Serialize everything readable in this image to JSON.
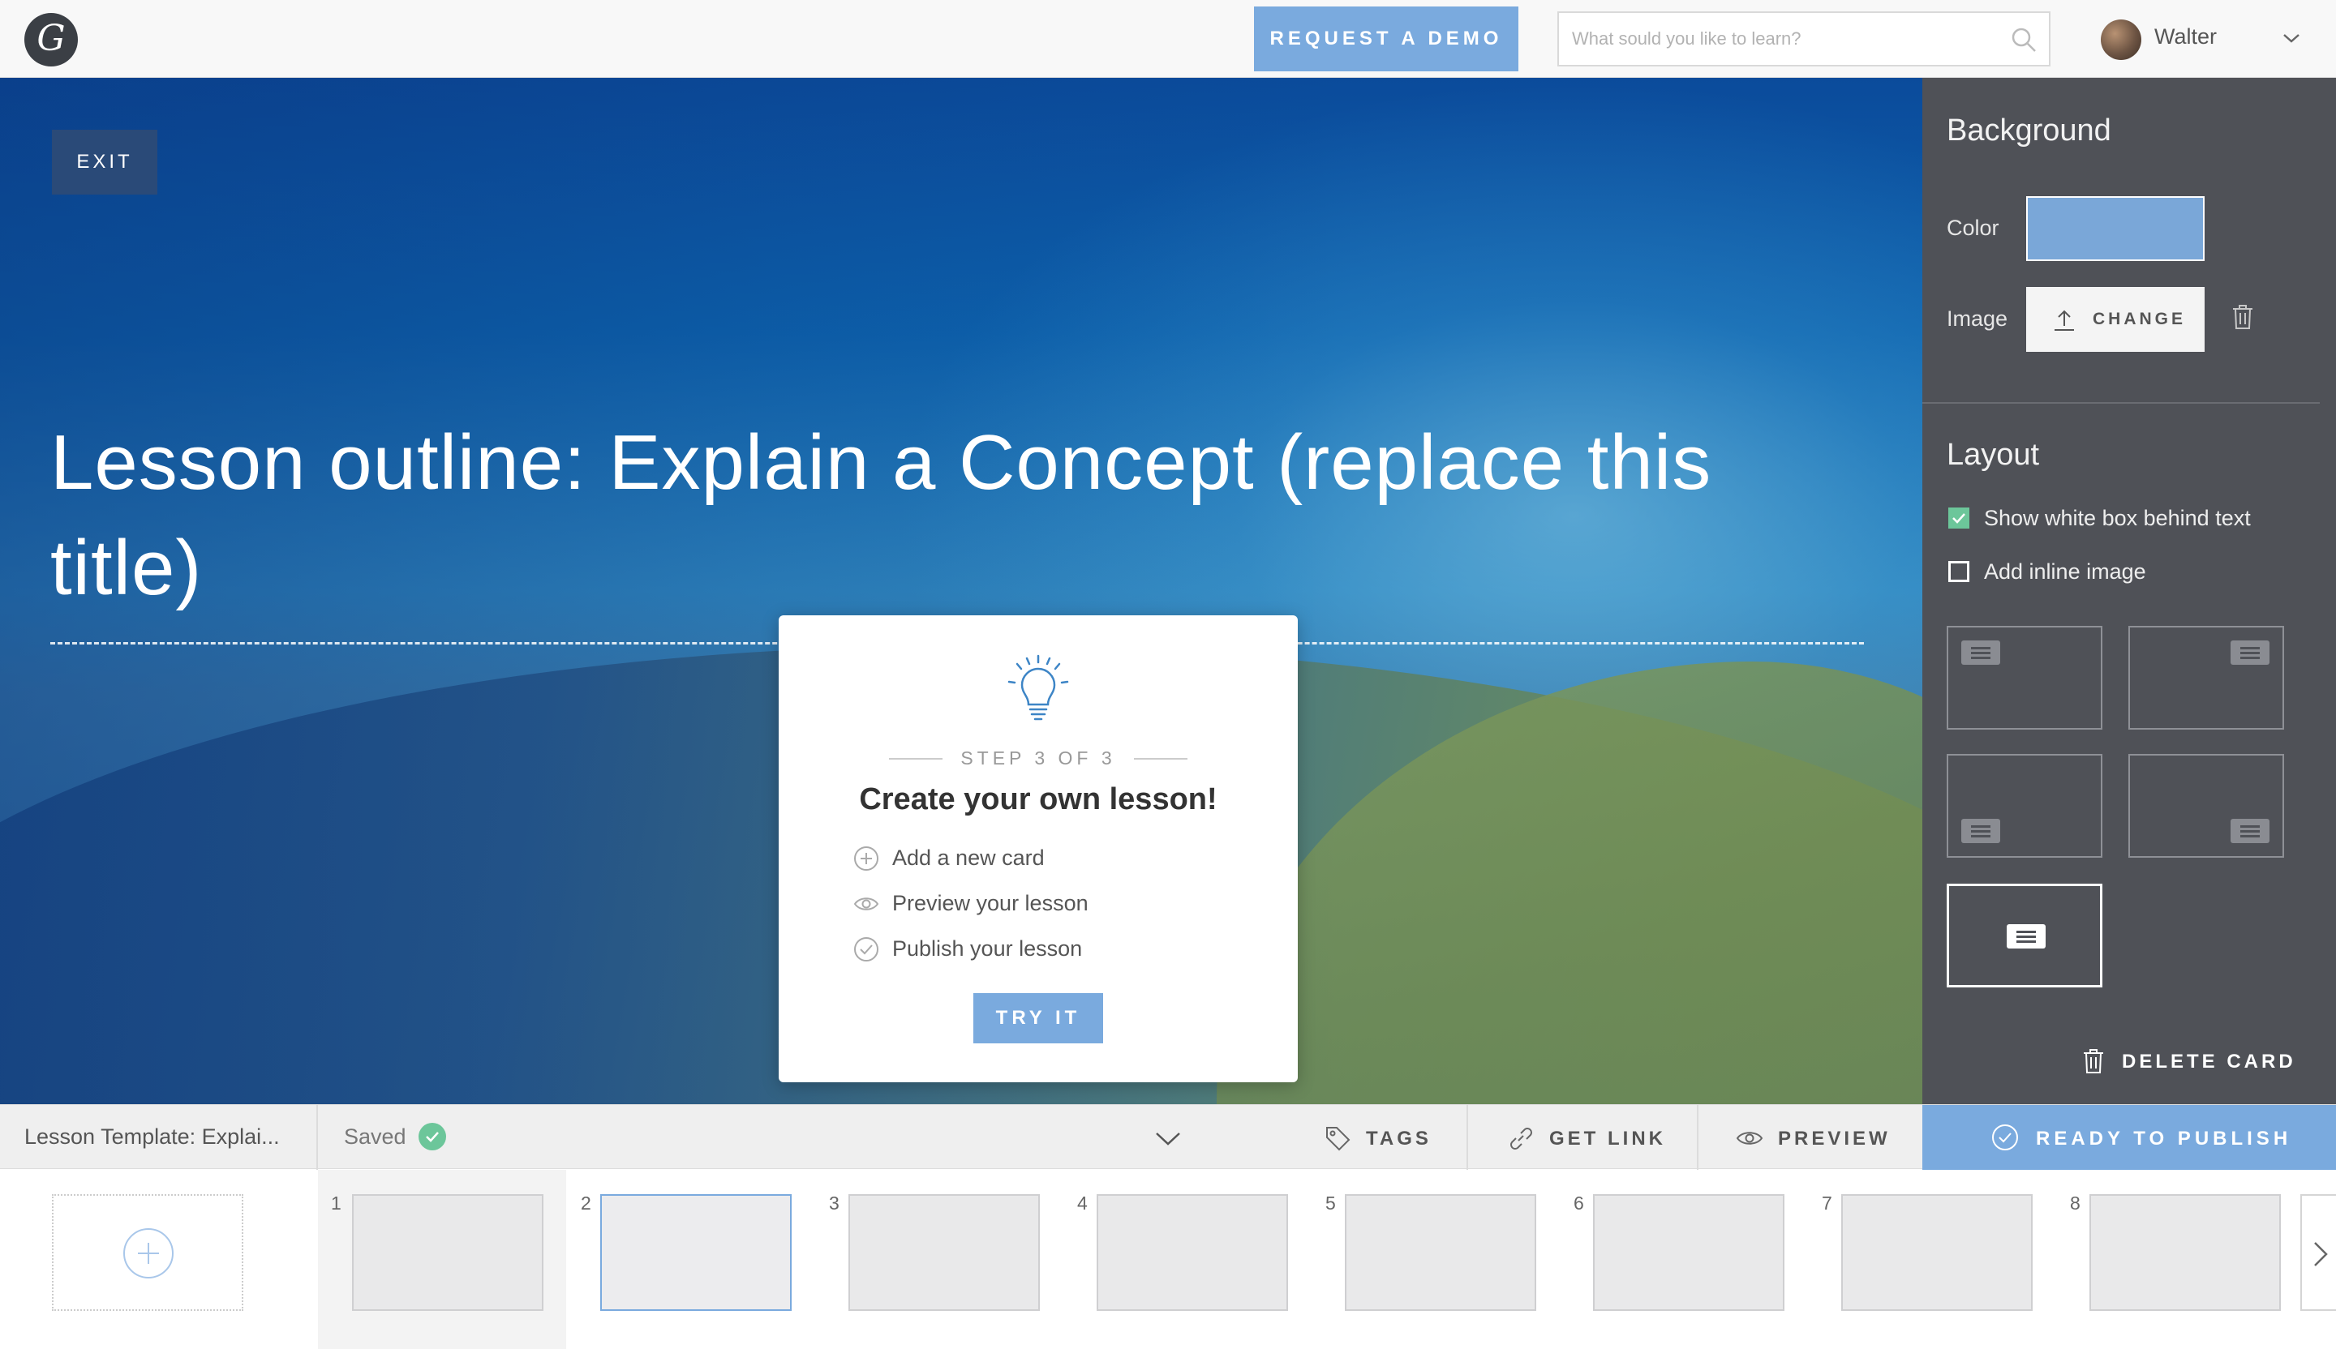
{
  "topbar": {
    "logo_letter": "G",
    "demo_label": "REQUEST A DEMO",
    "search_placeholder": "What sould you like to learn?",
    "username": "Walter",
    "icons": {
      "search": "search-icon",
      "chevron": "chevron-down-icon"
    }
  },
  "hero": {
    "exit_label": "EXIT",
    "title": "Lesson outline: Explain a Concept (replace this title)"
  },
  "tour": {
    "step": "STEP 3 OF 3",
    "heading": "Create your own lesson!",
    "items": [
      {
        "label": "Add a new card",
        "icon": "plus-circle-icon"
      },
      {
        "label": "Preview your lesson",
        "icon": "eye-icon"
      },
      {
        "label": "Publish your lesson",
        "icon": "check-circle-icon"
      }
    ],
    "try_label": "TRY IT"
  },
  "panel": {
    "background_title": "Background",
    "color_label": "Color",
    "color_value": "#7aa7d8",
    "image_label": "Image",
    "change_label": "CHANGE",
    "layout_title": "Layout",
    "options": [
      {
        "label": "Show white box behind text",
        "checked": true
      },
      {
        "label": "Add inline image",
        "checked": false
      }
    ],
    "delete_label": "DELETE CARD"
  },
  "toolbar": {
    "lesson_name": "Lesson Template: Explai...",
    "saved_label": "Saved",
    "tags_label": "TAGS",
    "link_label": "GET LINK",
    "preview_label": "PREVIEW",
    "publish_label": "READY TO PUBLISH"
  },
  "filmstrip": {
    "cards": [
      "1",
      "2",
      "3",
      "4",
      "5",
      "6",
      "7",
      "8"
    ],
    "active_card": "2"
  },
  "colors": {
    "accent": "#7aaade",
    "panel": "#4f5157",
    "success": "#6cc69a"
  }
}
